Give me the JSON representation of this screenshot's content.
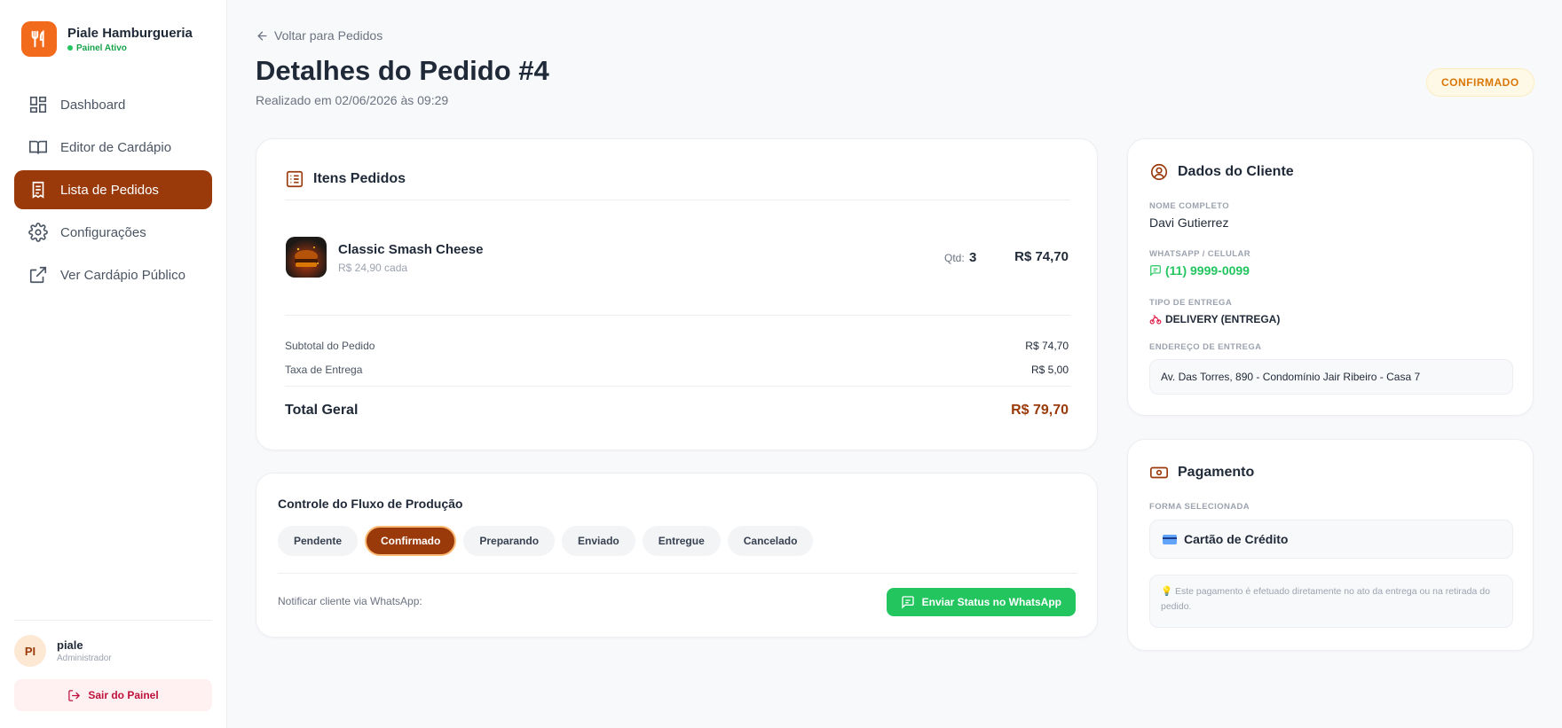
{
  "brand": {
    "name": "Piale Hamburgueria",
    "status": "Painel Ativo"
  },
  "nav": {
    "items": [
      {
        "label": "Dashboard",
        "icon": "dashboard-icon"
      },
      {
        "label": "Editor de Cardápio",
        "icon": "book-icon"
      },
      {
        "label": "Lista de Pedidos",
        "icon": "receipt-icon",
        "active": true
      },
      {
        "label": "Configurações",
        "icon": "gear-icon"
      },
      {
        "label": "Ver Cardápio Público",
        "icon": "external-link-icon"
      }
    ]
  },
  "user": {
    "initials": "PI",
    "name": "piale",
    "role": "Administrador",
    "logout_label": "Sair do Painel"
  },
  "header": {
    "back_label": "Voltar para Pedidos",
    "title": "Detalhes do Pedido #4",
    "subtitle": "Realizado em 02/06/2026 às 09:29",
    "status": "CONFIRMADO"
  },
  "items": {
    "title": "Itens Pedidos",
    "list": [
      {
        "name": "Classic Smash Cheese",
        "unit_price": "R$ 24,90 cada",
        "qty_label": "Qtd:",
        "qty": "3",
        "total": "R$ 74,70"
      }
    ],
    "subtotal_label": "Subtotal do Pedido",
    "subtotal": "R$ 74,70",
    "fee_label": "Taxa de Entrega",
    "fee": "R$ 5,00",
    "total_label": "Total Geral",
    "total": "R$ 79,70"
  },
  "production": {
    "title": "Controle do Fluxo de Produção",
    "statuses": [
      "Pendente",
      "Confirmado",
      "Preparando",
      "Enviado",
      "Entregue",
      "Cancelado"
    ],
    "active": "Confirmado",
    "notify_label": "Notificar cliente via WhatsApp:",
    "whatsapp_button": "Enviar Status no WhatsApp"
  },
  "client": {
    "title": "Dados do Cliente",
    "name_label": "NOME COMPLETO",
    "name": "Davi Gutierrez",
    "phone_label": "WHATSAPP / CELULAR",
    "phone": "(11) 9999-0099",
    "delivery_label": "TIPO DE ENTREGA",
    "delivery": "DELIVERY (ENTREGA)",
    "address_label": "ENDEREÇO DE ENTREGA",
    "address": "Av. Das Torres, 890 - Condomínio Jair Ribeiro - Casa 7"
  },
  "payment": {
    "title": "Pagamento",
    "method_label": "FORMA SELECIONADA",
    "method": "Cartão de Crédito",
    "note": "Este pagamento é efetuado diretamente no ato da entrega ou na retirada do pedido."
  },
  "colors": {
    "accent": "#9a3a0b",
    "brand": "#f26a1b",
    "whatsapp": "#22c55e",
    "status": "#d97706"
  }
}
